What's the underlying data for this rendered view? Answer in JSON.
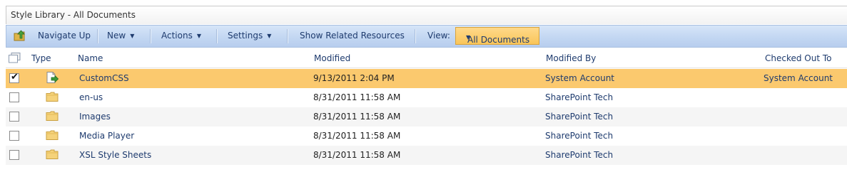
{
  "title": "Style Library - All Documents",
  "toolbar": {
    "navigate_up": "Navigate Up",
    "new": "New",
    "actions": "Actions",
    "settings": "Settings",
    "show_related": "Show Related Resources",
    "view_label": "View:",
    "view_value": "All Documents"
  },
  "columns": {
    "type": "Type",
    "name": "Name",
    "modified": "Modified",
    "modified_by": "Modified By",
    "checked_out_to": "Checked Out To"
  },
  "rows": [
    {
      "name": "CustomCSS",
      "modified": "9/13/2011 2:04 PM",
      "modified_by": "System Account",
      "checked_out_to": "System Account",
      "icon": "checked-out-document-icon",
      "selected": true
    },
    {
      "name": "en-us",
      "modified": "8/31/2011 11:58 AM",
      "modified_by": "SharePoint Tech",
      "checked_out_to": "",
      "icon": "folder-icon",
      "selected": false
    },
    {
      "name": "Images",
      "modified": "8/31/2011 11:58 AM",
      "modified_by": "SharePoint Tech",
      "checked_out_to": "",
      "icon": "folder-icon",
      "selected": false
    },
    {
      "name": "Media Player",
      "modified": "8/31/2011 11:58 AM",
      "modified_by": "SharePoint Tech",
      "checked_out_to": "",
      "icon": "folder-icon",
      "selected": false
    },
    {
      "name": "XSL Style Sheets",
      "modified": "8/31/2011 11:58 AM",
      "modified_by": "SharePoint Tech",
      "checked_out_to": "",
      "icon": "folder-icon",
      "selected": false
    }
  ],
  "colors": {
    "toolbar_bg": "#c3d7f2",
    "selected_row": "#fbc96e",
    "link_text": "#1e3b6e",
    "view_highlight": "#f9c55a"
  }
}
